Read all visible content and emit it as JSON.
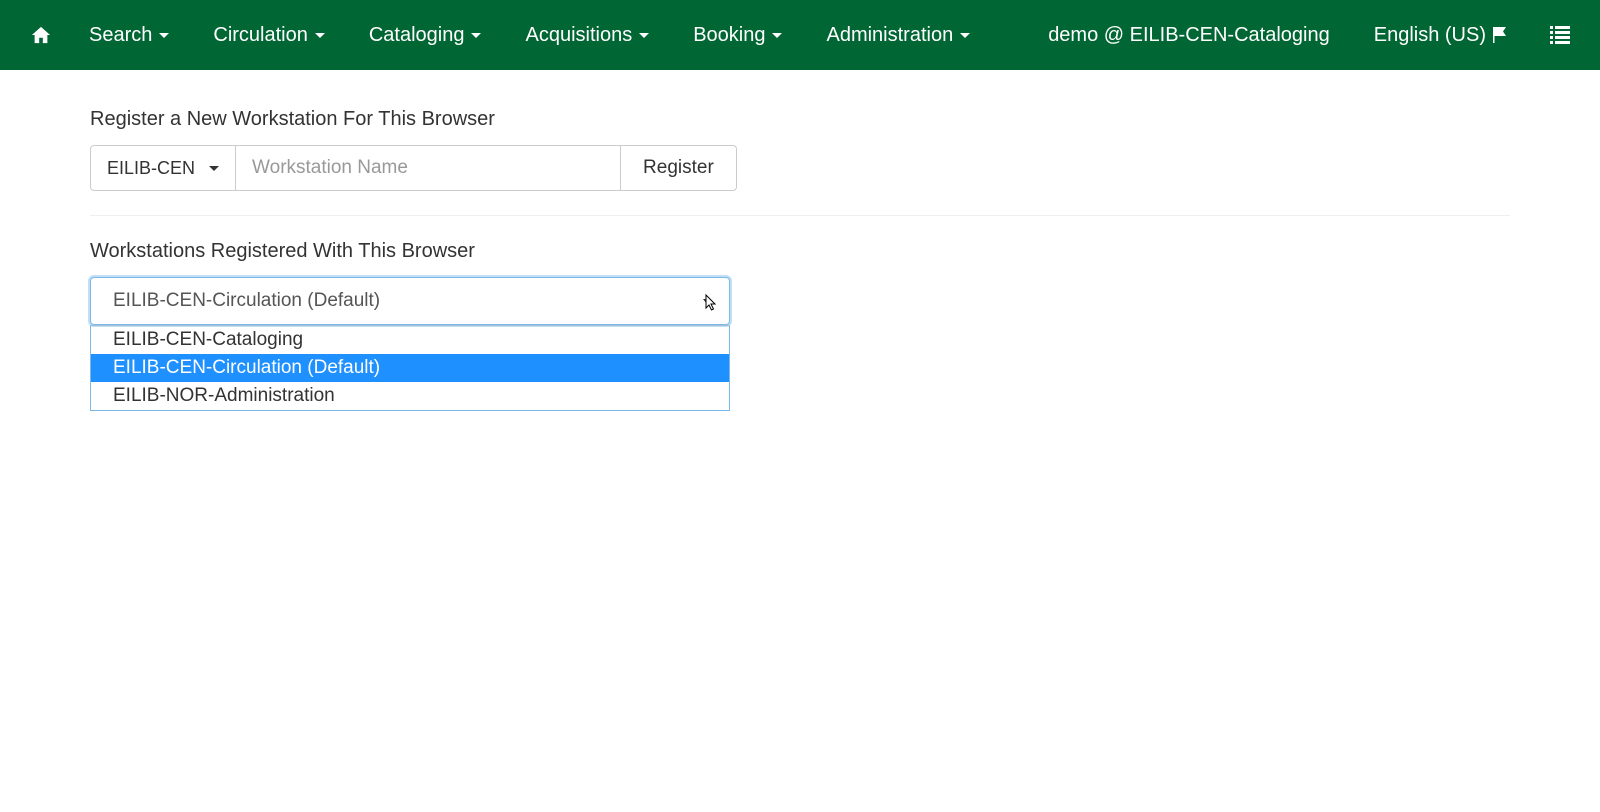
{
  "navbar": {
    "menu": {
      "search": "Search",
      "circulation": "Circulation",
      "cataloging": "Cataloging",
      "acquisitions": "Acquisitions",
      "booking": "Booking",
      "administration": "Administration"
    },
    "user_info": "demo @ EILIB-CEN-Cataloging",
    "locale": "English (US)"
  },
  "register": {
    "heading": "Register a New Workstation For This Browser",
    "org_selected": "EILIB-CEN",
    "input_placeholder": "Workstation Name",
    "button_label": "Register"
  },
  "registered": {
    "heading": "Workstations Registered With This Browser",
    "selected": "EILIB-CEN-Circulation (Default)",
    "options": [
      "EILIB-CEN-Cataloging",
      "EILIB-CEN-Circulation (Default)",
      "EILIB-NOR-Administration"
    ],
    "highlighted_index": 1
  }
}
